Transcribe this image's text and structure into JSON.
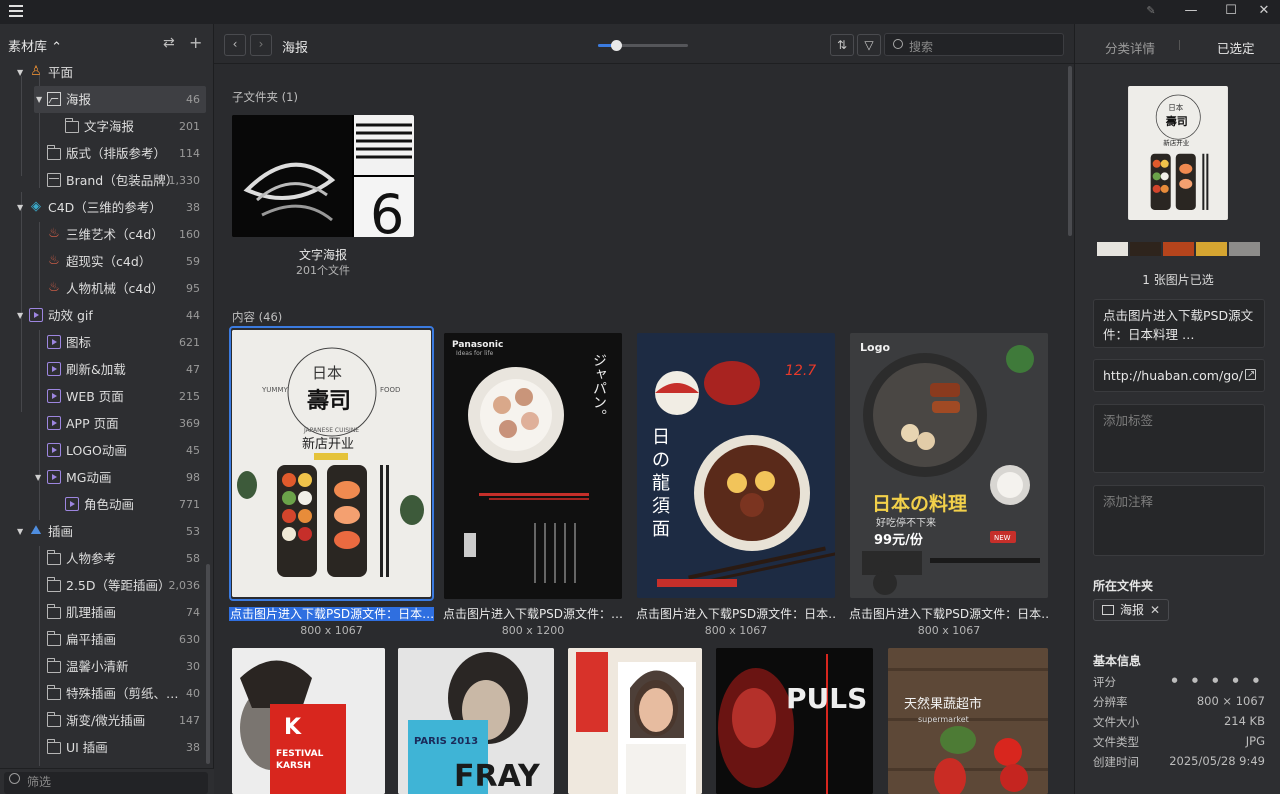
{
  "window": {
    "pin_icon": "pin-icon",
    "minimize": "—",
    "maximize": "☐",
    "close": "✕"
  },
  "sidebar": {
    "library_title": "素材库 ⌃",
    "tree": [
      {
        "label": "平面",
        "count": "",
        "icon": "plane-icon"
      },
      {
        "label": "海报",
        "count": "46",
        "icon": "image-icon"
      },
      {
        "label": "文字海报",
        "count": "201",
        "icon": "folder-icon"
      },
      {
        "label": "版式（排版参考）",
        "count": "114",
        "icon": "folder-icon"
      },
      {
        "label": "Brand（包装品牌）",
        "count": "1,330",
        "icon": "brand-icon"
      },
      {
        "label": "C4D（三维的参考）",
        "count": "38",
        "icon": "cube-icon"
      },
      {
        "label": "三维艺术（c4d）",
        "count": "160",
        "icon": "flame-icon"
      },
      {
        "label": "超现实（c4d）",
        "count": "59",
        "icon": "flame-icon"
      },
      {
        "label": "人物机械（c4d）",
        "count": "95",
        "icon": "flame-icon"
      },
      {
        "label": "动效 gif",
        "count": "44",
        "icon": "gif-icon"
      },
      {
        "label": "图标",
        "count": "621",
        "icon": "gif-icon"
      },
      {
        "label": "刷新&加载",
        "count": "47",
        "icon": "gif-icon"
      },
      {
        "label": "WEB 页面",
        "count": "215",
        "icon": "gif-icon"
      },
      {
        "label": "APP 页面",
        "count": "369",
        "icon": "gif-icon"
      },
      {
        "label": "LOGO动画",
        "count": "45",
        "icon": "gif-icon"
      },
      {
        "label": "MG动画",
        "count": "98",
        "icon": "gif-icon"
      },
      {
        "label": "角色动画",
        "count": "771",
        "icon": "gif-icon"
      },
      {
        "label": "插画",
        "count": "53",
        "icon": "illustration-icon"
      },
      {
        "label": "人物参考",
        "count": "58",
        "icon": "folder-icon"
      },
      {
        "label": "2.5D（等距插画）",
        "count": "2,036",
        "icon": "folder-icon"
      },
      {
        "label": "肌理插画",
        "count": "74",
        "icon": "folder-icon"
      },
      {
        "label": "扁平插画",
        "count": "630",
        "icon": "folder-icon"
      },
      {
        "label": "温馨小清新",
        "count": "30",
        "icon": "folder-icon"
      },
      {
        "label": "特殊插画（剪纸、…",
        "count": "40",
        "icon": "folder-icon"
      },
      {
        "label": "渐变/微光插画",
        "count": "147",
        "icon": "folder-icon"
      },
      {
        "label": "UI 插画",
        "count": "38",
        "icon": "folder-icon"
      }
    ],
    "filter_placeholder": "筛选"
  },
  "toolbar": {
    "breadcrumb": "海报",
    "search_placeholder": "搜索",
    "zoom": 0.2
  },
  "content": {
    "subfolders_header": "子文件夹 (1)",
    "subfolder": {
      "name": "文字海报",
      "count_text": "201个文件"
    },
    "items_header": "内容 (46)",
    "items": [
      {
        "caption": "点击图片进入下载PSD源文件：日本…",
        "size": "800 x 1067"
      },
      {
        "caption": "点击图片进入下载PSD源文件：…",
        "size": "800 x 1200"
      },
      {
        "caption": "点击图片进入下载PSD源文件：日本…",
        "size": "800 x 1067"
      },
      {
        "caption": "点击图片进入下载PSD源文件：日本…",
        "size": "800 x 1067"
      }
    ]
  },
  "right": {
    "tab_details": "分类详情",
    "tab_selected": "已选定",
    "colors": [
      "#e6e4df",
      "#2e241c",
      "#b5441c",
      "#d5a531",
      "#8d8c8a"
    ],
    "selected_count": "1 张图片已选",
    "title": "点击图片进入下载PSD源文件：日本料理 …",
    "url": "http://huaban.com/go/",
    "tags_placeholder": "添加标签",
    "notes_placeholder": "添加注释",
    "folder_label": "所在文件夹",
    "folder_chip": "海报",
    "basic_label": "基本信息",
    "info": [
      {
        "k": "评分",
        "v": "● ● ● ● ●"
      },
      {
        "k": "分辨率",
        "v": "800 × 1067"
      },
      {
        "k": "文件大小",
        "v": "214 KB"
      },
      {
        "k": "文件类型",
        "v": "JPG"
      },
      {
        "k": "创建时间",
        "v": "2025/05/28 9:49"
      }
    ]
  },
  "posters": {
    "p1": {
      "l1": "日本",
      "l2": "壽司",
      "l3": "新店开业",
      "l4": "YUMMY",
      "l5": "FOOD",
      "l6": "JAPANESE CUISINE"
    },
    "p2": {
      "brand": "Panasonic",
      "tag": "Ideas for life",
      "v": "ジャパン。"
    },
    "p3": {
      "v1": "日",
      "v2": "の",
      "v3": "龍",
      "v4": "須",
      "v5": "面",
      "tag": "12.7"
    },
    "p4": {
      "logo": "Logo",
      "t": "日本の料理",
      "s": "好吃停不下来",
      "p": "99元/份",
      "n": "NEW"
    },
    "b1": {
      "t": "FESTIVAL",
      "s": "KARSH"
    },
    "b2": {
      "t": "PARIS 2013",
      "s": "FRAY"
    },
    "b4": {
      "t": "PULS"
    },
    "b5": {
      "t": "天然果蔬超市",
      "s": "supermarket"
    }
  }
}
